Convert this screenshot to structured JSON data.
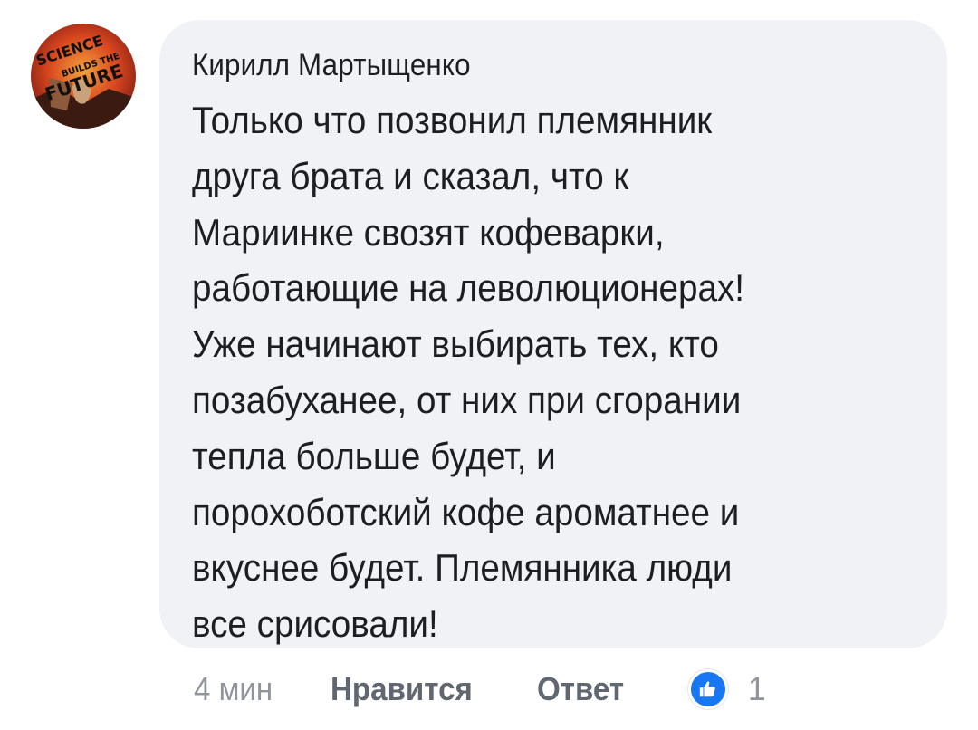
{
  "comment": {
    "author": "Кирилл Мартыщенко",
    "lines": [
      "Только что позвонил племянник",
      "друга брата и сказал, что к",
      "Мариинке свозят кофеварки,",
      "работающие на леволюционерах!",
      "Уже начинают выбирать тех, кто",
      "позабуханее, от них при сгорании",
      "тепла больше будет, и",
      "порохоботский кофе ароматнее и",
      "вкуснее будет. Племянника люди",
      "все срисовали!"
    ]
  },
  "actions": {
    "time": "4 мин",
    "like_label": "Нравится",
    "reply_label": "Ответ",
    "reaction_icon": "thumbs-up-icon",
    "reaction_count": "1"
  },
  "avatar": {
    "text_lines": [
      "SCIENCE",
      "BUILDS THE",
      "FUTURE"
    ]
  },
  "colors": {
    "bubble": "#f0f2f5",
    "text": "#1c1e21",
    "meta": "#90949c",
    "action": "#606770",
    "like": "#1877f2"
  }
}
